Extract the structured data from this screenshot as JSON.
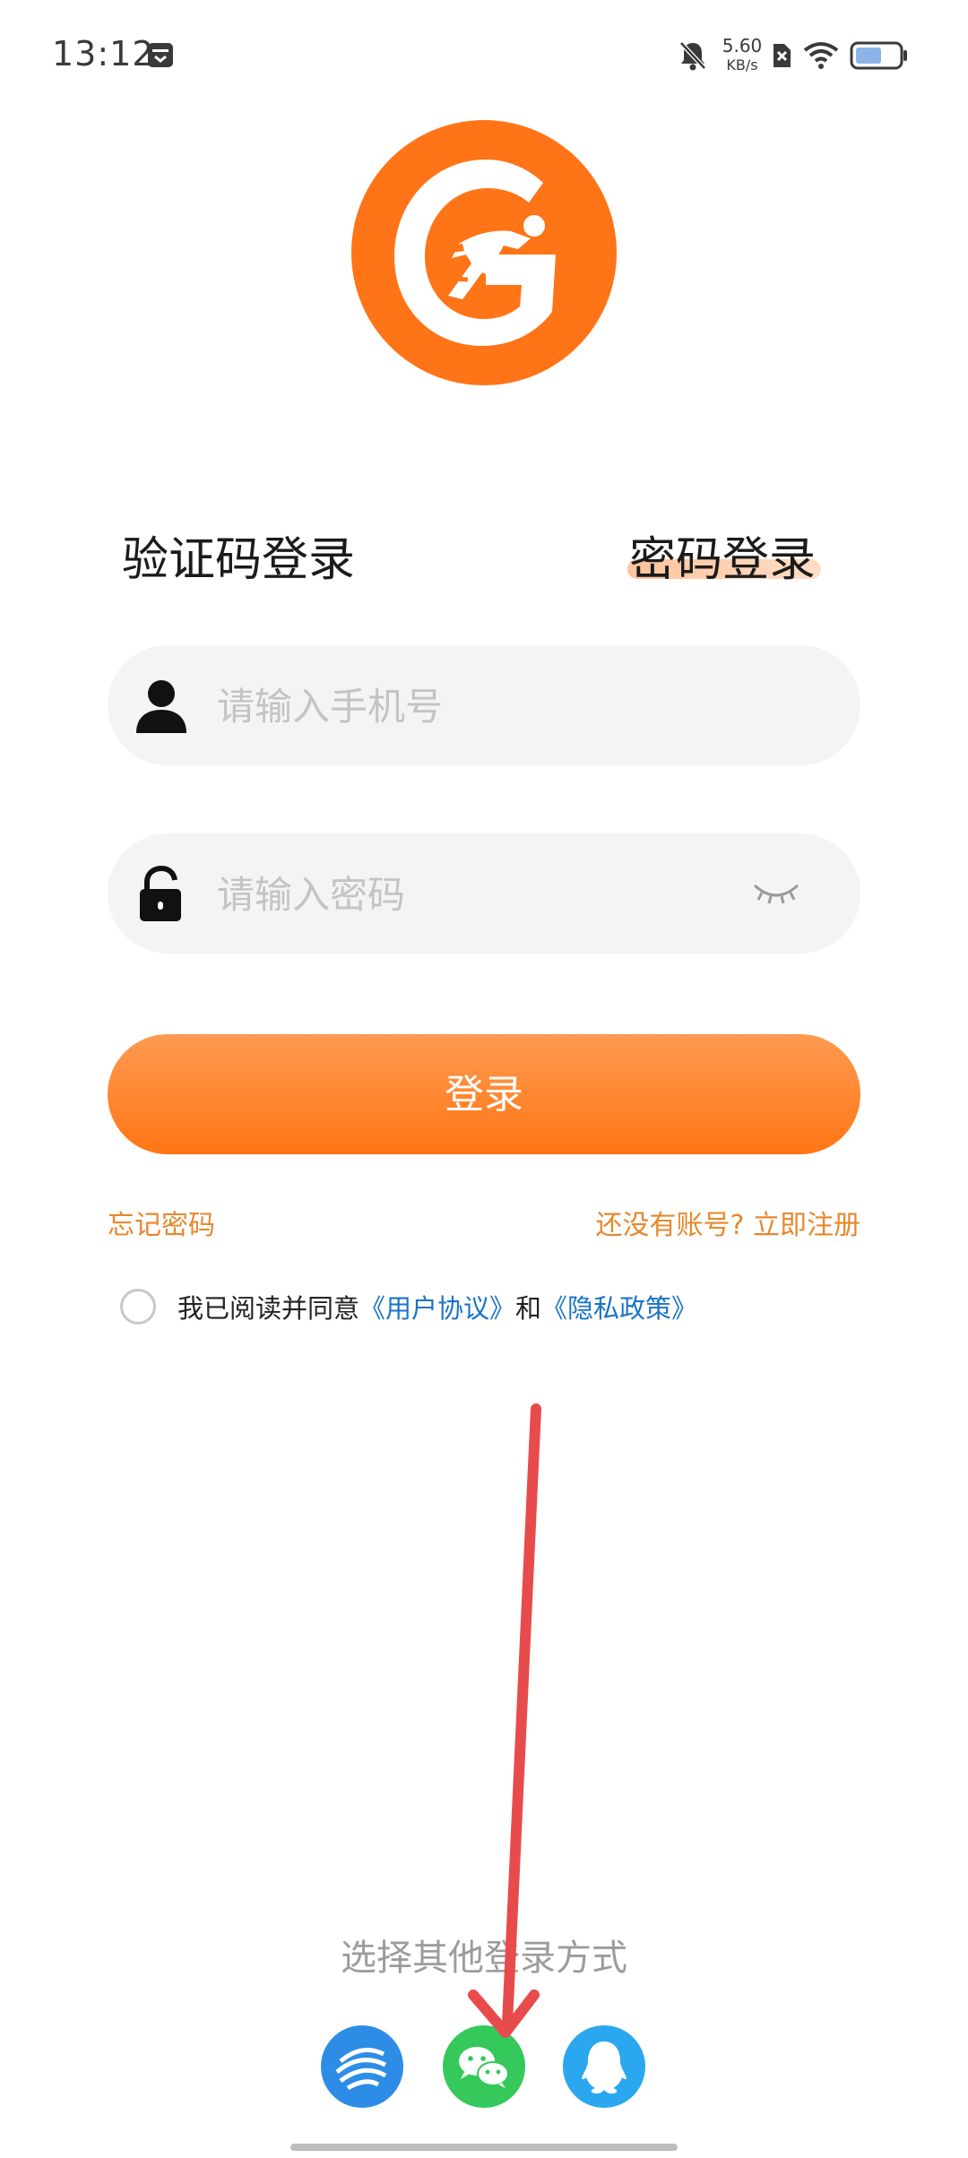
{
  "status_bar": {
    "time": "13:12",
    "net_speed_value": "5.60",
    "net_speed_unit": "KB/s",
    "icons": [
      "calendar-notify-icon",
      "mute-bell-icon",
      "no-sim-icon",
      "wifi-icon",
      "battery-icon"
    ]
  },
  "logo": {
    "icon": "app-logo-runner"
  },
  "tabs": {
    "code_login": "验证码登录",
    "password_login": "密码登录",
    "active": "password_login"
  },
  "form": {
    "phone_placeholder": "请输入手机号",
    "password_placeholder": "请输入密码",
    "login_label": "登录",
    "forgot": "忘记密码",
    "register": "还没有账号? 立即注册"
  },
  "agreement": {
    "prefix": "我已阅读并同意",
    "user_agreement": "《用户协议》",
    "and": "和",
    "privacy": "《隐私政策》"
  },
  "other_login": {
    "title": "选择其他登录方式",
    "options": [
      "china-mobile-icon",
      "wechat-icon",
      "qq-icon"
    ]
  },
  "colors": {
    "accent": "#ff7a1a",
    "link_blue": "#1a73c9",
    "link_orange": "#e8872c",
    "annotation": "#e84b4b"
  }
}
